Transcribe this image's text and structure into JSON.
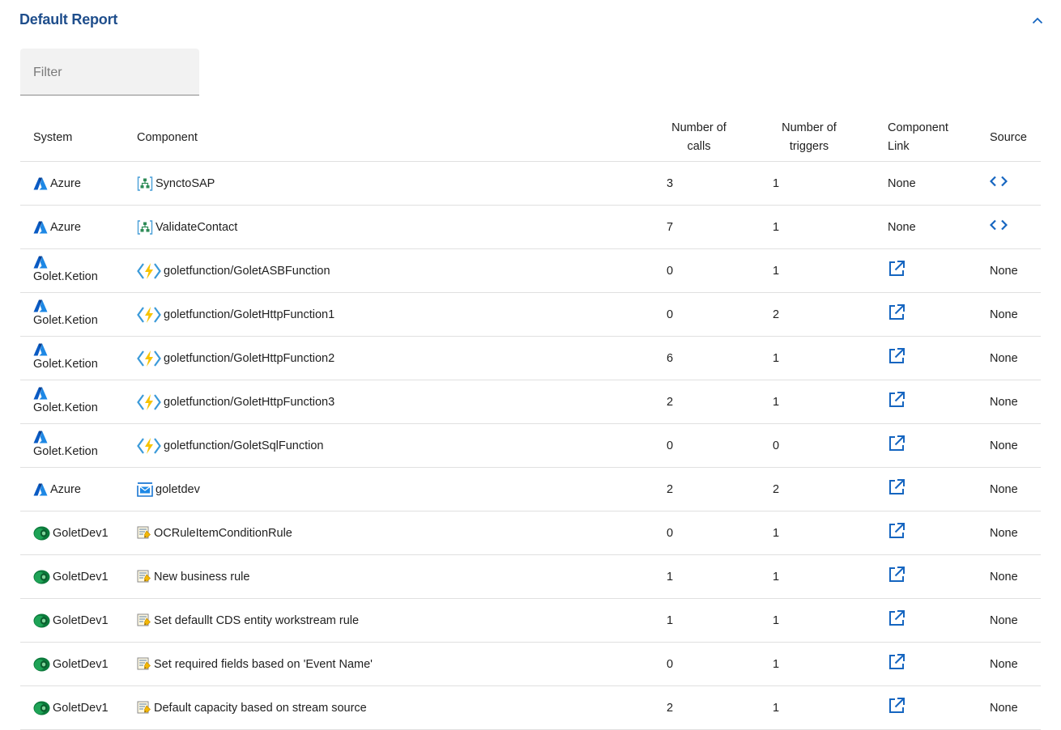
{
  "report": {
    "title": "Default Report"
  },
  "filter": {
    "placeholder": "Filter"
  },
  "columns": {
    "system": "System",
    "component": "Component",
    "calls_1": "Number of",
    "calls_2": "calls",
    "triggers_1": "Number of",
    "triggers_2": "triggers",
    "link_1": "Component",
    "link_2": "Link",
    "source": "Source"
  },
  "rows": [
    {
      "system": "Azure",
      "system_icon": "azure-icon",
      "system_stacked": false,
      "component": "SynctoSAP",
      "component_icon": "logic-app-icon",
      "calls": "3",
      "triggers": "1",
      "link": "None",
      "source": "code-icon"
    },
    {
      "system": "Azure",
      "system_icon": "azure-icon",
      "system_stacked": false,
      "component": "ValidateContact",
      "component_icon": "logic-app-icon",
      "calls": "7",
      "triggers": "1",
      "link": "None",
      "source": "code-icon"
    },
    {
      "system": "Golet.Ketion",
      "system_icon": "azure-icon",
      "system_stacked": true,
      "component": "goletfunction/GoletASBFunction",
      "component_icon": "function-app-icon",
      "calls": "0",
      "triggers": "1",
      "link": "open-external-icon",
      "source": "None"
    },
    {
      "system": "Golet.Ketion",
      "system_icon": "azure-icon",
      "system_stacked": true,
      "component": "goletfunction/GoletHttpFunction1",
      "component_icon": "function-app-icon",
      "calls": "0",
      "triggers": "2",
      "link": "open-external-icon",
      "source": "None"
    },
    {
      "system": "Golet.Ketion",
      "system_icon": "azure-icon",
      "system_stacked": true,
      "component": "goletfunction/GoletHttpFunction2",
      "component_icon": "function-app-icon",
      "calls": "6",
      "triggers": "1",
      "link": "open-external-icon",
      "source": "None"
    },
    {
      "system": "Golet.Ketion",
      "system_icon": "azure-icon",
      "system_stacked": true,
      "component": "goletfunction/GoletHttpFunction3",
      "component_icon": "function-app-icon",
      "calls": "2",
      "triggers": "1",
      "link": "open-external-icon",
      "source": "None"
    },
    {
      "system": "Golet.Ketion",
      "system_icon": "azure-icon",
      "system_stacked": true,
      "component": "goletfunction/GoletSqlFunction",
      "component_icon": "function-app-icon",
      "calls": "0",
      "triggers": "0",
      "link": "open-external-icon",
      "source": "None"
    },
    {
      "system": "Azure",
      "system_icon": "azure-icon",
      "system_stacked": false,
      "component": "goletdev",
      "component_icon": "service-bus-icon",
      "calls": "2",
      "triggers": "2",
      "link": "open-external-icon",
      "source": "None"
    },
    {
      "system": "GoletDev1",
      "system_icon": "dataverse-icon",
      "system_stacked": false,
      "component": "OCRuleItemConditionRule",
      "component_icon": "business-rule-icon",
      "calls": "0",
      "triggers": "1",
      "link": "open-external-icon",
      "source": "None"
    },
    {
      "system": "GoletDev1",
      "system_icon": "dataverse-icon",
      "system_stacked": false,
      "component": "New business rule",
      "component_icon": "business-rule-icon",
      "calls": "1",
      "triggers": "1",
      "link": "open-external-icon",
      "source": "None"
    },
    {
      "system": "GoletDev1",
      "system_icon": "dataverse-icon",
      "system_stacked": false,
      "component": "Set defaullt CDS entity workstream rule",
      "component_icon": "business-rule-icon",
      "calls": "1",
      "triggers": "1",
      "link": "open-external-icon",
      "source": "None"
    },
    {
      "system": "GoletDev1",
      "system_icon": "dataverse-icon",
      "system_stacked": false,
      "component": "Set required fields based on 'Event Name'",
      "component_icon": "business-rule-icon",
      "calls": "0",
      "triggers": "1",
      "link": "open-external-icon",
      "source": "None"
    },
    {
      "system": "GoletDev1",
      "system_icon": "dataverse-icon",
      "system_stacked": false,
      "component": "Default capacity based on stream source",
      "component_icon": "business-rule-icon",
      "calls": "2",
      "triggers": "1",
      "link": "open-external-icon",
      "source": "None"
    }
  ],
  "icons": {
    "collapse": "chevron-up-icon"
  },
  "colors": {
    "title": "#1f4e8c",
    "accent": "#1565c0"
  }
}
